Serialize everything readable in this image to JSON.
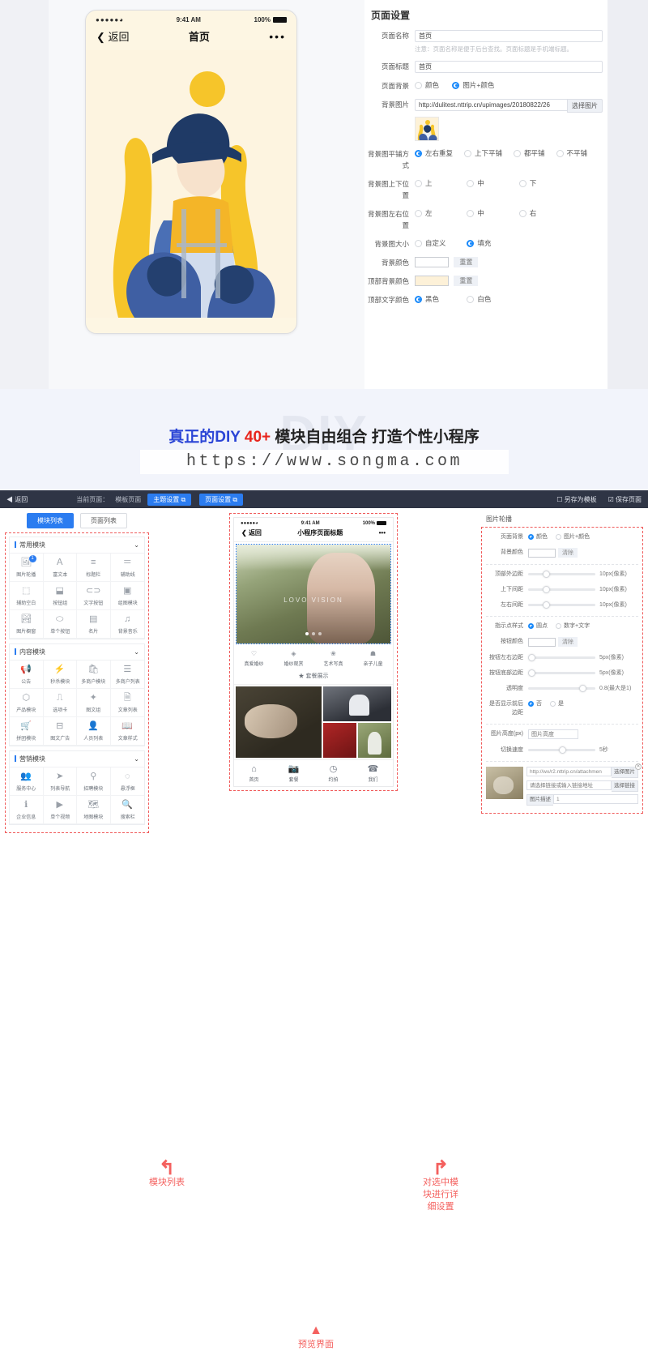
{
  "top": {
    "phone": {
      "signal": "●●●●●",
      "wifi": "wifi-icon",
      "time": "9:41 AM",
      "battery": "100%",
      "back": "返回",
      "title": "首页",
      "more": "•••"
    },
    "settings": {
      "panel_title": "页面设置",
      "fields": {
        "page_name_label": "页面名称",
        "page_name_value": "首页",
        "page_name_hint": "注意：页面名称是便于后台查找。页面标题是手机端标题。",
        "page_title_label": "页面标题",
        "page_title_value": "首页",
        "page_bg_label": "页面背景",
        "page_bg_opt1": "颜色",
        "page_bg_opt2": "图片+颜色",
        "bg_image_label": "背景图片",
        "bg_image_value": "http://dulitest.nttrip.cn/upimages/20180822/26",
        "bg_image_btn": "选择图片",
        "tile_label": "背景图平铺方式",
        "tile_opt1": "左右重复",
        "tile_opt2": "上下平铺",
        "tile_opt3": "都平铺",
        "tile_opt4": "不平铺",
        "vpos_label": "背景图上下位置",
        "vpos_opt1": "上",
        "vpos_opt2": "中",
        "vpos_opt3": "下",
        "hpos_label": "背景图左右位置",
        "hpos_opt1": "左",
        "hpos_opt2": "中",
        "hpos_opt3": "右",
        "size_label": "背景图大小",
        "size_opt1": "自定义",
        "size_opt2": "填充",
        "bgcolor_label": "背景颜色",
        "bgcolor_reset": "重置",
        "topbg_label": "顶部背景颜色",
        "topbg_reset": "重置",
        "toptext_label": "顶部文字颜色",
        "toptext_opt1": "黑色",
        "toptext_opt2": "白色"
      }
    }
  },
  "banner": {
    "part1": "真正的DIY",
    "part2": "40+",
    "part3": "模块自由组合  打造个性小程序",
    "ghost": "DIY",
    "watermark": "https://www.songma.com"
  },
  "editor": {
    "toolbar": {
      "back": "◀ 返回",
      "current_page_label": "当前页面：",
      "current_page_value": "模板页面",
      "theme_btn": "主题设置 ⧉",
      "page_btn": "页面设置 ⧉",
      "save_template": "另存为模板",
      "save_page": "保存页面"
    },
    "module_panel": {
      "tab_modules": "模块列表",
      "tab_pages": "页面列表",
      "groups": [
        {
          "title": "常用模块",
          "items": [
            {
              "icon": "🖼",
              "label": "图片轮播",
              "badge": "1"
            },
            {
              "icon": "Ａ",
              "label": "富文本",
              "badge": ""
            },
            {
              "icon": "≡",
              "label": "标题栏",
              "badge": ""
            },
            {
              "icon": "＝",
              "label": "辅助线",
              "badge": ""
            },
            {
              "icon": "⬚",
              "label": "辅助空白",
              "badge": ""
            },
            {
              "icon": "⬓",
              "label": "按钮组",
              "badge": ""
            },
            {
              "icon": "⊂⊃",
              "label": "文字按钮",
              "badge": ""
            },
            {
              "icon": "▣",
              "label": "组图模块",
              "badge": ""
            },
            {
              "icon": "🏞",
              "label": "图片橱窗",
              "badge": ""
            },
            {
              "icon": "⬭",
              "label": "单个按钮",
              "badge": ""
            },
            {
              "icon": "▤",
              "label": "名片",
              "badge": ""
            },
            {
              "icon": "♫",
              "label": "背景音乐",
              "badge": ""
            }
          ]
        },
        {
          "title": "内容模块",
          "items": [
            {
              "icon": "📢",
              "label": "公告",
              "badge": ""
            },
            {
              "icon": "⚡",
              "label": "秒杀模块",
              "badge": ""
            },
            {
              "icon": "🛍",
              "label": "多商户模块",
              "badge": ""
            },
            {
              "icon": "☰",
              "label": "多商户列表",
              "badge": ""
            },
            {
              "icon": "⬡",
              "label": "产品模块",
              "badge": ""
            },
            {
              "icon": "⎍",
              "label": "选项卡",
              "badge": ""
            },
            {
              "icon": "✦",
              "label": "图文组",
              "badge": ""
            },
            {
              "icon": "🗎",
              "label": "文章列表",
              "badge": ""
            },
            {
              "icon": "🛒",
              "label": "拼团模块",
              "badge": ""
            },
            {
              "icon": "⊟",
              "label": "图文广告",
              "badge": ""
            },
            {
              "icon": "👤",
              "label": "人员列表",
              "badge": ""
            },
            {
              "icon": "📖",
              "label": "文章样式",
              "badge": ""
            }
          ]
        },
        {
          "title": "营销模块",
          "items": [
            {
              "icon": "👥",
              "label": "服务中心",
              "badge": ""
            },
            {
              "icon": "➤",
              "label": "列表导航",
              "badge": ""
            },
            {
              "icon": "⚲",
              "label": "招聘模块",
              "badge": ""
            },
            {
              "icon": "◌",
              "label": "悬浮框",
              "badge": ""
            },
            {
              "icon": "ℹ",
              "label": "企业信息",
              "badge": ""
            },
            {
              "icon": "▶",
              "label": "单个视频",
              "badge": ""
            },
            {
              "icon": "🗺",
              "label": "地图模块",
              "badge": ""
            },
            {
              "icon": "🔍",
              "label": "搜索栏",
              "badge": ""
            }
          ]
        }
      ]
    },
    "preview": {
      "signal": "●●●●●",
      "time": "9:41 AM",
      "battery": "100%",
      "back": "返回",
      "title": "小程序页面标题",
      "more": "•••",
      "hero_text": "LOVO VISION",
      "nav_items": [
        {
          "icon": "♡",
          "label": "真爱婚纱"
        },
        {
          "icon": "◈",
          "label": "婚纱观赏"
        },
        {
          "icon": "❀",
          "label": "艺术写真"
        },
        {
          "icon": "☗",
          "label": "亲子儿童"
        }
      ],
      "sublabel": "套餐展示",
      "tabbar": [
        {
          "icon": "⌂",
          "label": "首页"
        },
        {
          "icon": "📷",
          "label": "套餐"
        },
        {
          "icon": "◷",
          "label": "约拍"
        },
        {
          "icon": "☎",
          "label": "我们"
        }
      ]
    },
    "settings_panel": {
      "title": "图片轮播",
      "page_bg_label": "页面背景",
      "page_bg_opt1": "颜色",
      "page_bg_opt2": "图片+颜色",
      "bgcolor_label": "背景颜色",
      "clear": "清除",
      "top_margin_label": "顶部外边距",
      "top_margin_value": "10px(像素)",
      "vgap_label": "上下间距",
      "vgap_value": "10px(像素)",
      "hgap_label": "左右间距",
      "hgap_value": "10px(像素)",
      "dot_style_label": "指示点样式",
      "dot_opt1": "圆点",
      "dot_opt2": "数字+文字",
      "btn_color_label": "按钮颜色",
      "btn_hmargin_label": "按钮左右边距",
      "btn_hmargin_value": "5px(像素)",
      "btn_bmargin_label": "按钮底部边距",
      "btn_bmargin_value": "5px(像素)",
      "opacity_label": "透明度",
      "opacity_value": "0.8(最大是1)",
      "showgap_label": "是否显示前后边距",
      "showgap_opt1": "否",
      "showgap_opt2": "是",
      "height_label": "图片高度(px)",
      "height_placeholder": "图片高度",
      "speed_label": "切换速度",
      "speed_value": "5秒",
      "img_url": "http://wx/r2.nttrip.cn/attachmen",
      "img_select_btn": "选择图片",
      "link_placeholder": "请选择链接或输入链接地址",
      "link_btn": "选择链接",
      "desc_label": "图片描述",
      "desc_value": "1"
    },
    "annotations": {
      "left": "模块列表",
      "right_line1": "对选中模",
      "right_line2": "块进行详",
      "right_line3": "细设置",
      "bottom": "预览界面"
    }
  },
  "colors": {
    "accent": "#2b7cf0",
    "annotation": "#f4605e",
    "toolbar_bg": "#2f3545",
    "banner_bg": "#f2f4fb",
    "phone_cream": "#fdf4e0"
  }
}
